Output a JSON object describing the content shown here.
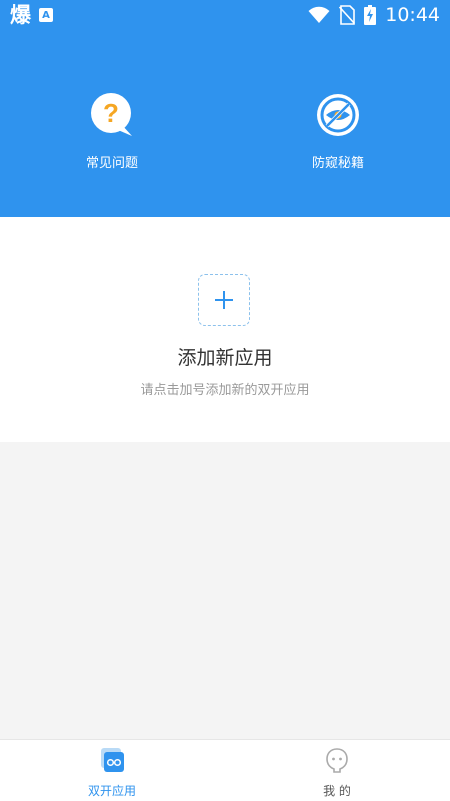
{
  "colors": {
    "accent": "#2f93ee",
    "faq_question_mark": "#f5a623",
    "anti_icon": "#2f93ee"
  },
  "status_bar": {
    "app_glyph": "爆",
    "notification_icon": "A",
    "time": "10:44",
    "icons": [
      "wifi-icon",
      "no-sim-icon",
      "battery-charging-icon"
    ]
  },
  "header": {
    "features": [
      {
        "label": "常见问题",
        "icon": "question-bubble-icon"
      },
      {
        "label": "防窥秘籍",
        "icon": "eye-slash-icon"
      }
    ]
  },
  "add_app": {
    "title": "添加新应用",
    "subtitle": "请点击加号添加新的双开应用"
  },
  "tab_bar": {
    "tabs": [
      {
        "label": "双开应用",
        "icon": "dual-app-icon",
        "active": true
      },
      {
        "label": "我 的",
        "icon": "profile-icon",
        "active": false
      }
    ]
  }
}
